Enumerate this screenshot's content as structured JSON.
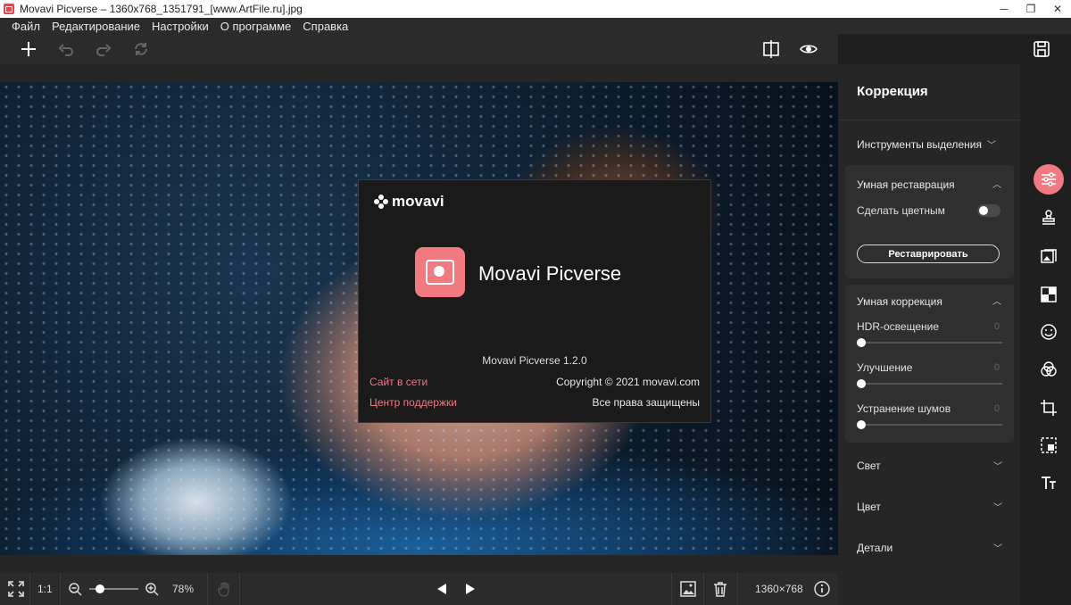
{
  "window": {
    "title": "Movavi Picverse – 1360x768_1351791_[www.ArtFile.ru].jpg",
    "minimize": "─",
    "maximize": "❐",
    "close": "✕"
  },
  "menu": [
    "Файл",
    "Редактирование",
    "Настройки",
    "О программе",
    "Справка"
  ],
  "about": {
    "brand": "movavi",
    "product_name": "Movavi Picverse",
    "version": "Movavi Picverse 1.2.0",
    "website_link": "Сайт в сети",
    "support_link": "Центр поддержки",
    "copyright": "Copyright © 2021 movavi.com",
    "rights": "Все права защищены"
  },
  "statusbar": {
    "ratio": "1:1",
    "zoom": "78%",
    "zoom_fraction": 0.15,
    "dimensions": "1360×768"
  },
  "panel": {
    "title": "Коррекция",
    "selection_tools": "Инструменты выделения",
    "smart_restore": {
      "title": "Умная реставрация",
      "colorize_label": "Сделать цветным",
      "colorize_on": false,
      "restore_button": "Реставрировать"
    },
    "smart_correction": {
      "title": "Умная коррекция",
      "sliders": [
        {
          "label": "HDR-освещение",
          "value": "0"
        },
        {
          "label": "Улучшение",
          "value": "0"
        },
        {
          "label": "Устранение шумов",
          "value": "0"
        }
      ]
    },
    "collapsed": [
      "Свет",
      "Цвет",
      "Детали"
    ]
  },
  "colors": {
    "accent": "#f07a80",
    "background": "#1f1f1f",
    "panel": "#262626"
  },
  "rail_icons": [
    "adjust-icon",
    "stamp-icon",
    "image-replace-icon",
    "background-icon",
    "face-icon",
    "filters-icon",
    "crop-icon",
    "select-object-icon",
    "text-icon"
  ]
}
